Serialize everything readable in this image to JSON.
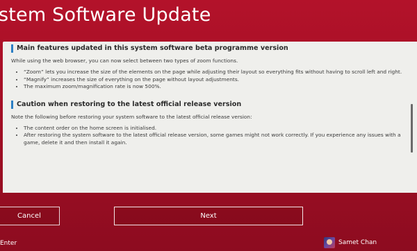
{
  "window": {
    "title": "stem Software Update"
  },
  "content": {
    "section1": {
      "heading": "Main features updated in this system software beta programme version",
      "intro": "While using the web browser, you can now select between two types of zoom functions.",
      "bullets": [
        "“Zoom” lets you increase the size of the elements on the page while adjusting their layout so everything fits without having to scroll left and right.",
        "“Magnify” increases the size of everything on the page without layout adjustments.",
        "The maximum zoom/magnification rate is now 500%."
      ]
    },
    "section2": {
      "heading": "Caution when restoring to the latest official release version",
      "intro": "Note the following before restoring your system software to the latest official release version:",
      "bullets": [
        "The content order on the home screen is initialised.",
        "After restoring the system software to the latest official release version, some games might not work correctly. If you experience any issues with a game, delete it and then install it again."
      ]
    }
  },
  "buttons": {
    "cancel": "Cancel",
    "next": "Next"
  },
  "footer": {
    "enter_hint": "Enter",
    "user_name": "Samet Chan"
  },
  "colors": {
    "background": "#a30f25",
    "panel": "#efefec",
    "heading_bar": "#2c7fc4"
  }
}
